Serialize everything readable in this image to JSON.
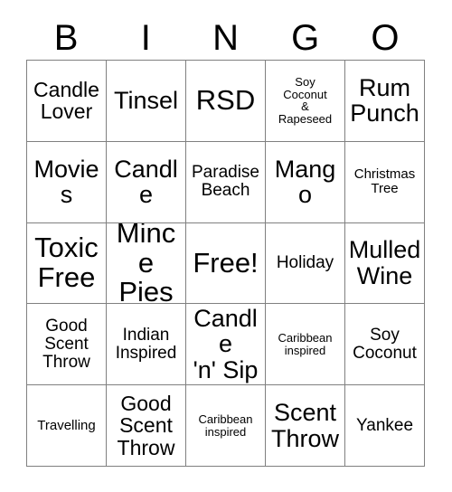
{
  "card": {
    "header_letters": [
      "B",
      "I",
      "N",
      "G",
      "O"
    ],
    "columns": 5,
    "rows": 5,
    "border_color": "#808080",
    "text_color": "#000000",
    "background_color": "#ffffff",
    "free_space_label": "Free!",
    "free_space_position": "row3-col3"
  },
  "cells": [
    {
      "text": "Candle\nLover",
      "size": "fs-lg",
      "row": 1,
      "col": 1
    },
    {
      "text": "Tinsel",
      "size": "fs-xl",
      "row": 1,
      "col": 2
    },
    {
      "text": "RSD",
      "size": "fs-xxl",
      "row": 1,
      "col": 3
    },
    {
      "text": "Soy\nCoconut\n&\nRapeseed",
      "size": "fs-xs",
      "row": 1,
      "col": 4
    },
    {
      "text": "Rum\nPunch",
      "size": "fs-xl",
      "row": 1,
      "col": 5
    },
    {
      "text": "Movies",
      "size": "fs-xl",
      "row": 2,
      "col": 1
    },
    {
      "text": "Candle",
      "size": "fs-xl",
      "row": 2,
      "col": 2
    },
    {
      "text": "Paradise\nBeach",
      "size": "fs-md",
      "row": 2,
      "col": 3
    },
    {
      "text": "Mango",
      "size": "fs-xl",
      "row": 2,
      "col": 4
    },
    {
      "text": "Christmas\nTree",
      "size": "fs-sm",
      "row": 2,
      "col": 5
    },
    {
      "text": "Toxic\nFree",
      "size": "fs-xxl",
      "row": 3,
      "col": 1
    },
    {
      "text": "Mince\nPies",
      "size": "fs-xxl",
      "row": 3,
      "col": 2
    },
    {
      "text": "Free!",
      "size": "fs-xxl",
      "row": 3,
      "col": 3
    },
    {
      "text": "Holiday",
      "size": "fs-md",
      "row": 3,
      "col": 4
    },
    {
      "text": "Mulled\nWine",
      "size": "fs-xl",
      "row": 3,
      "col": 5
    },
    {
      "text": "Good\nScent\nThrow",
      "size": "fs-md",
      "row": 4,
      "col": 1
    },
    {
      "text": "Indian\nInspired",
      "size": "fs-md",
      "row": 4,
      "col": 2
    },
    {
      "text": "Candle\n'n' Sip",
      "size": "fs-xl",
      "row": 4,
      "col": 3
    },
    {
      "text": "Caribbean\ninspired",
      "size": "fs-xs",
      "row": 4,
      "col": 4
    },
    {
      "text": "Soy\nCoconut",
      "size": "fs-md",
      "row": 4,
      "col": 5
    },
    {
      "text": "Travelling",
      "size": "fs-sm",
      "row": 5,
      "col": 1
    },
    {
      "text": "Good\nScent\nThrow",
      "size": "fs-lg",
      "row": 5,
      "col": 2
    },
    {
      "text": "Caribbean\ninspired",
      "size": "fs-xs",
      "row": 5,
      "col": 3
    },
    {
      "text": "Scent\nThrow",
      "size": "fs-xl",
      "row": 5,
      "col": 4
    },
    {
      "text": "Yankee",
      "size": "fs-md",
      "row": 5,
      "col": 5
    }
  ]
}
